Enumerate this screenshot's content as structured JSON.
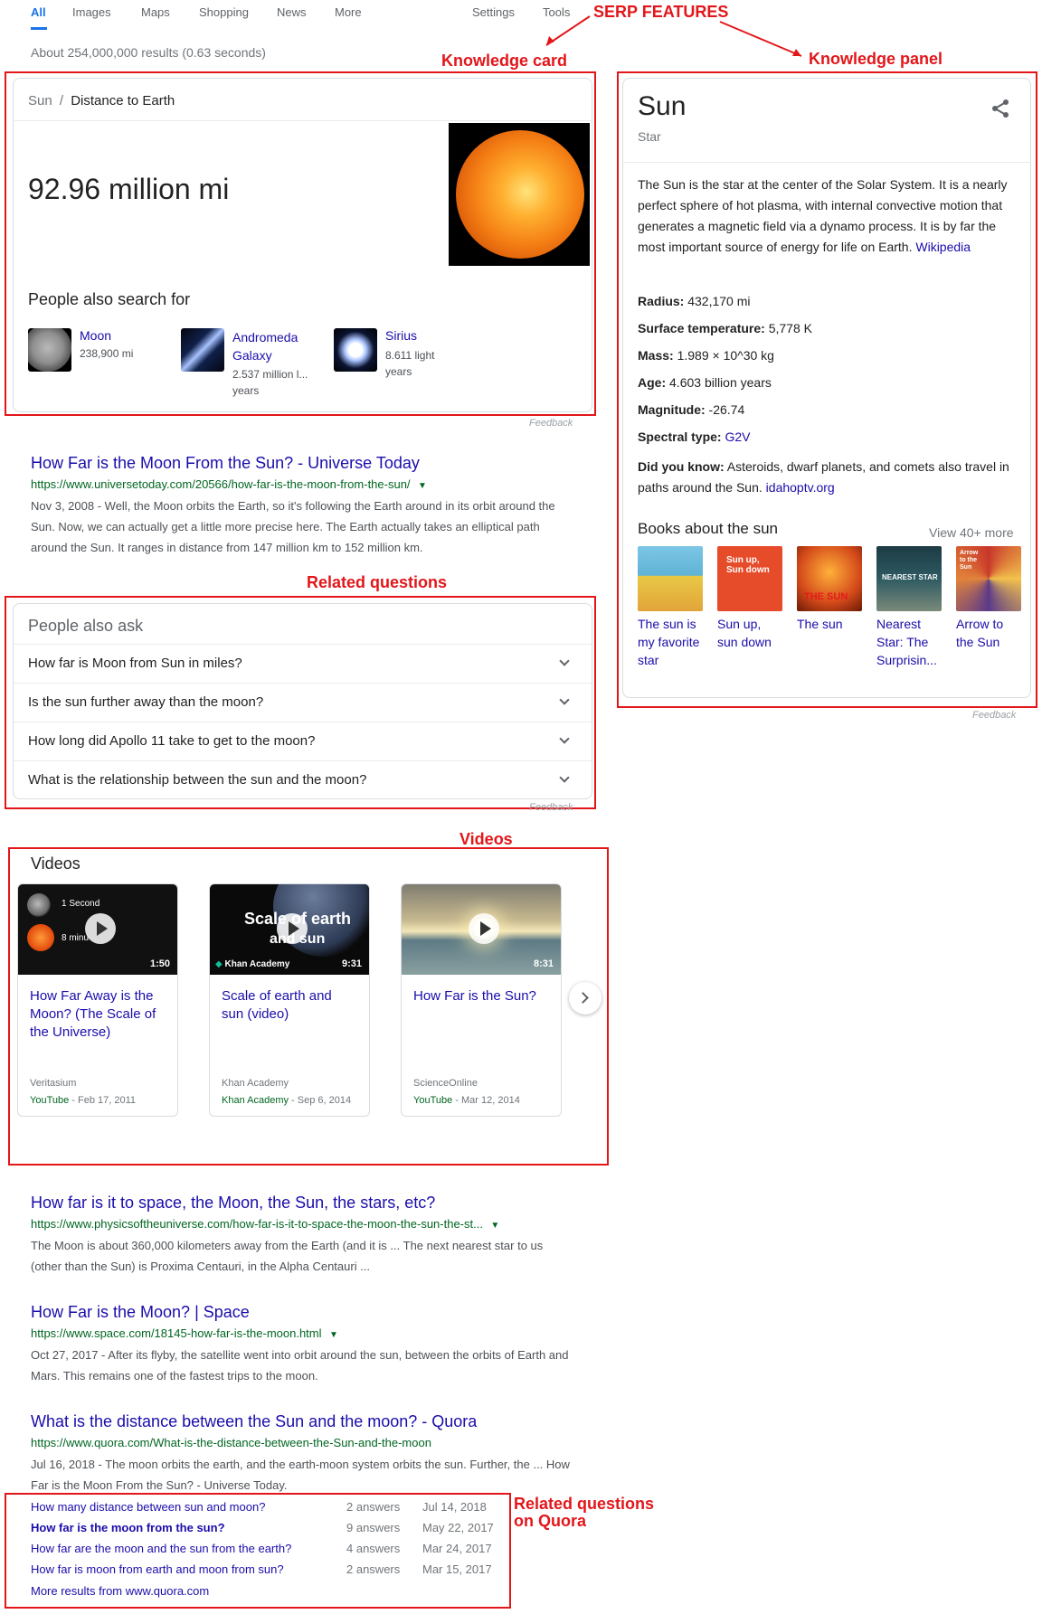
{
  "nav": {
    "tabs": [
      "All",
      "Images",
      "Maps",
      "Shopping",
      "News",
      "More"
    ],
    "right": [
      "Settings",
      "Tools"
    ]
  },
  "annotations": {
    "serp_features": "SERP FEATURES",
    "knowledge_card": "Knowledge card",
    "knowledge_panel": "Knowledge panel",
    "related_questions": "Related questions",
    "videos": "Videos",
    "related_quora_1": "Related questions",
    "related_quora_2": "on Quora"
  },
  "stats": "About 254,000,000 results (0.63 seconds)",
  "knowledge_card": {
    "breadcrumb_sun": "Sun",
    "breadcrumb_sep": "/",
    "breadcrumb_topic": "Distance to Earth",
    "distance": "92.96 million mi",
    "also_search_heading": "People also search for",
    "items": [
      {
        "name": "Moon",
        "value": "238,900 mi"
      },
      {
        "name": "Andromeda Galaxy",
        "value": "2.537 million l... years"
      },
      {
        "name": "Sirius",
        "value": "8.611 light years"
      }
    ],
    "feedback": "Feedback"
  },
  "result1": {
    "title": "How Far is the Moon From the Sun? - Universe Today",
    "url": "https://www.universetoday.com/20566/how-far-is-the-moon-from-the-sun/",
    "snippet": "Nov 3, 2008 - Well, the Moon orbits the Earth, so it's following the Earth around in its orbit around the Sun. Now, we can actually get a little more precise here. The Earth actually takes an elliptical path around the Sun. It ranges in distance from 147 million km to 152 million km."
  },
  "paa": {
    "heading": "People also ask",
    "questions": [
      "How far is Moon from Sun in miles?",
      "Is the sun further away than the moon?",
      "How long did Apollo 11 take to get to the moon?",
      "What is the relationship between the sun and the moon?"
    ],
    "feedback": "Feedback"
  },
  "videos": {
    "heading": "Videos",
    "items": [
      {
        "title": "How Far Away is the Moon? (The Scale of the Universe)",
        "duration": "1:50",
        "channel": "Veritasium",
        "source": "YouTube",
        "date": "Feb 17, 2011",
        "thumb_text1": "1 Second",
        "thumb_text2": "8 minu"
      },
      {
        "title": "Scale of earth and sun (video)",
        "duration": "9:31",
        "channel": "Khan Academy",
        "source": "Khan Academy",
        "date": "Sep 6, 2014",
        "thumb_text1": "Scale of earth",
        "thumb_text2": "and sun",
        "badge": "Khan Academy"
      },
      {
        "title": "How Far is the Sun?",
        "duration": "8:31",
        "channel": "ScienceOnline",
        "source": "YouTube",
        "date": "Mar 12, 2014"
      }
    ],
    "date_sep": " - "
  },
  "result2": {
    "title": "How far is it to space, the Moon, the Sun, the stars, etc?",
    "url": "https://www.physicsoftheuniverse.com/how-far-is-it-to-space-the-moon-the-sun-the-st...",
    "snippet": "The Moon is about 360,000 kilometers away from the Earth (and it is ... The next nearest star to us (other than the Sun) is Proxima Centauri, in the Alpha Centauri ..."
  },
  "result3": {
    "title": "How Far is the Moon? | Space",
    "url": "https://www.space.com/18145-how-far-is-the-moon.html",
    "snippet": "Oct 27, 2017 - After its flyby, the satellite went into orbit around the sun, between the orbits of Earth and Mars. This remains one of the fastest trips to the moon."
  },
  "result4": {
    "title": "What is the distance between the Sun and the moon? - Quora",
    "url": "https://www.quora.com/What-is-the-distance-between-the-Sun-and-the-moon",
    "snippet": "Jul 16, 2018 - The moon orbits the earth, and the earth-moon system orbits the sun. Further, the ... How Far is the Moon From the Sun? - Universe Today.",
    "questions": [
      {
        "q": "How many distance between sun and moon?",
        "answers": "2 answers",
        "date": "Jul 14, 2018"
      },
      {
        "q": "How far is the moon from the sun?",
        "answers": "9 answers",
        "date": "May 22, 2017"
      },
      {
        "q": "How far are the moon and the sun from the earth?",
        "answers": "4 answers",
        "date": "Mar 24, 2017"
      },
      {
        "q": "How far is moon from earth and moon from sun?",
        "answers": "2 answers",
        "date": "Mar 15, 2017"
      }
    ],
    "more": "More results from www.quora.com"
  },
  "panel": {
    "title": "Sun",
    "subtitle": "Star",
    "description": "The Sun is the star at the center of the Solar System. It is a nearly perfect sphere of hot plasma, with internal convective motion that generates a magnetic field via a dynamo process. It is by far the most important source of energy for life on Earth.",
    "wiki": "Wikipedia",
    "facts": [
      {
        "label": "Radius:",
        "value": "432,170 mi"
      },
      {
        "label": "Surface temperature:",
        "value": "5,778 K"
      },
      {
        "label": "Mass:",
        "value": "1.989 × 10^30 kg"
      },
      {
        "label": "Age:",
        "value": "4.603 billion years"
      },
      {
        "label": "Magnitude:",
        "value": "-26.74"
      },
      {
        "label": "Spectral type:",
        "value": "G2V"
      }
    ],
    "did_you_know_label": "Did you know:",
    "did_you_know": "Asteroids, dwarf planets, and comets also travel in paths around the Sun.",
    "did_you_know_src": "idahoptv.org",
    "books_heading": "Books about the sun",
    "view_more": "View 40+ more",
    "books": [
      {
        "title": "The sun is my favorite star",
        "color": "#5fb3d6"
      },
      {
        "title": "Sun up, sun down",
        "color": "#e64b2a"
      },
      {
        "title": "The sun",
        "color": "#d44a1a"
      },
      {
        "title": "Nearest Star: The Surprisin...",
        "color": "#2e5a62"
      },
      {
        "title": "Arrow to the Sun",
        "color": "#c8372a"
      }
    ],
    "book_cover_texts": [
      "Sun up, Sun down",
      "THE SUN",
      "NEAREST STAR",
      "Arrow to the Sun"
    ],
    "feedback": "Feedback"
  }
}
